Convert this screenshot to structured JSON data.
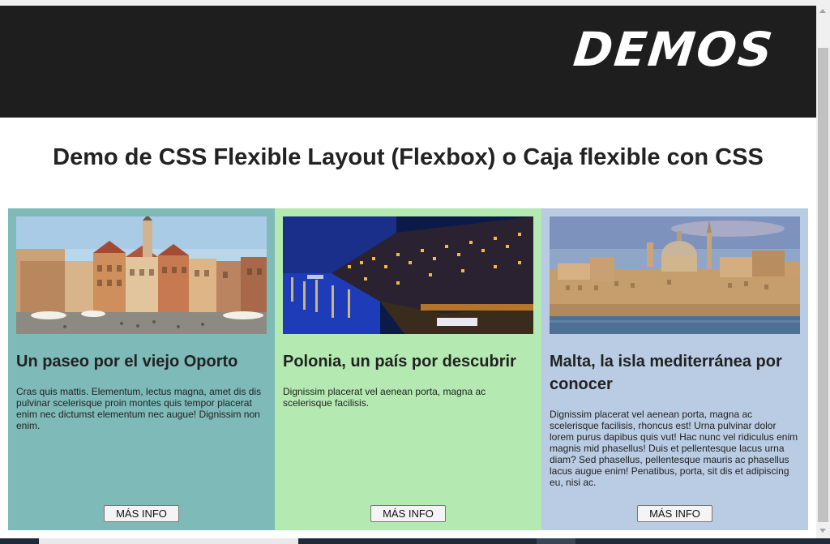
{
  "header": {
    "logo_text": "DEMOS"
  },
  "page": {
    "title": "Demo de CSS Flexible Layout (Flexbox) o Caja flexible con CSS"
  },
  "cards": [
    {
      "title": "Un paseo por el viejo Oporto",
      "text": "Cras quis mattis. Elementum, lectus magna, amet dis dis pulvinar scelerisque proin montes quis tempor placerat enim nec dictumst elementum nec augue! Dignissim non enim.",
      "button": "MÁS INFO",
      "bg": "#7ebab8"
    },
    {
      "title": "Polonia, un país por descubrir",
      "text": "Dignissim placerat vel aenean porta, magna ac scelerisque facilisis.",
      "button": "MÁS INFO",
      "bg": "#b4eab1"
    },
    {
      "title": "Malta, la isla mediterránea por conocer",
      "text": "Dignissim placerat vel aenean porta, magna ac scelerisque facilisis, rhoncus est! Urna pulvinar dolor lorem purus dapibus quis vut! Hac nunc vel ridiculus enim magnis mid phasellus! Duis et pellentesque lacus urna diam? Sed phasellus, pellentesque mauris ac phasellus lacus augue enim! Penatibus, porta, sit dis et adipiscing eu, nisi ac.",
      "button": "MÁS INFO",
      "bg": "#b9cce3"
    }
  ]
}
